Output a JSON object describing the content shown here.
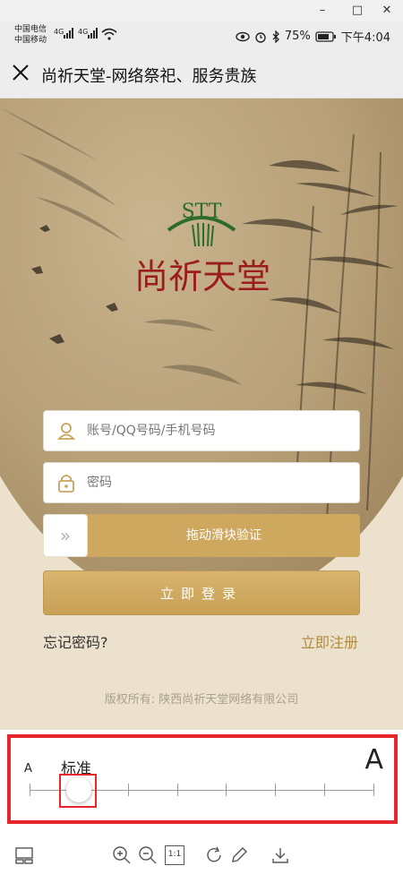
{
  "window": {
    "minimize": "–",
    "maximize": "□",
    "close": "✕"
  },
  "status": {
    "carrier1": "中国电信",
    "carrier2": "中国移动",
    "net1": "4G",
    "net2": "4G",
    "battery": "75%",
    "time": "下午4:04"
  },
  "nav": {
    "title": "尚祈天堂-网络祭祀、服务贵族"
  },
  "logo": {
    "letters": "STT",
    "name": "尚祈天堂"
  },
  "form": {
    "account_placeholder": "账号/QQ号码/手机号码",
    "password_placeholder": "密码",
    "slider_label": "拖动滑块验证",
    "slider_handle": "»",
    "login_label": "立即登录",
    "forgot": "忘记密码?",
    "register": "立即注册"
  },
  "copyright": "版权所有: 陕西尚祈天堂网络有限公司",
  "font_panel": {
    "small_label": "A",
    "current_label": "标准",
    "large_label": "A",
    "steps": 8,
    "selected_step": 1
  },
  "toolbar": {
    "actual_size_label": "1:1"
  },
  "colors": {
    "accent": "#cfa85f",
    "logo_red": "#9c1c1c",
    "highlight": "#e5262a"
  }
}
